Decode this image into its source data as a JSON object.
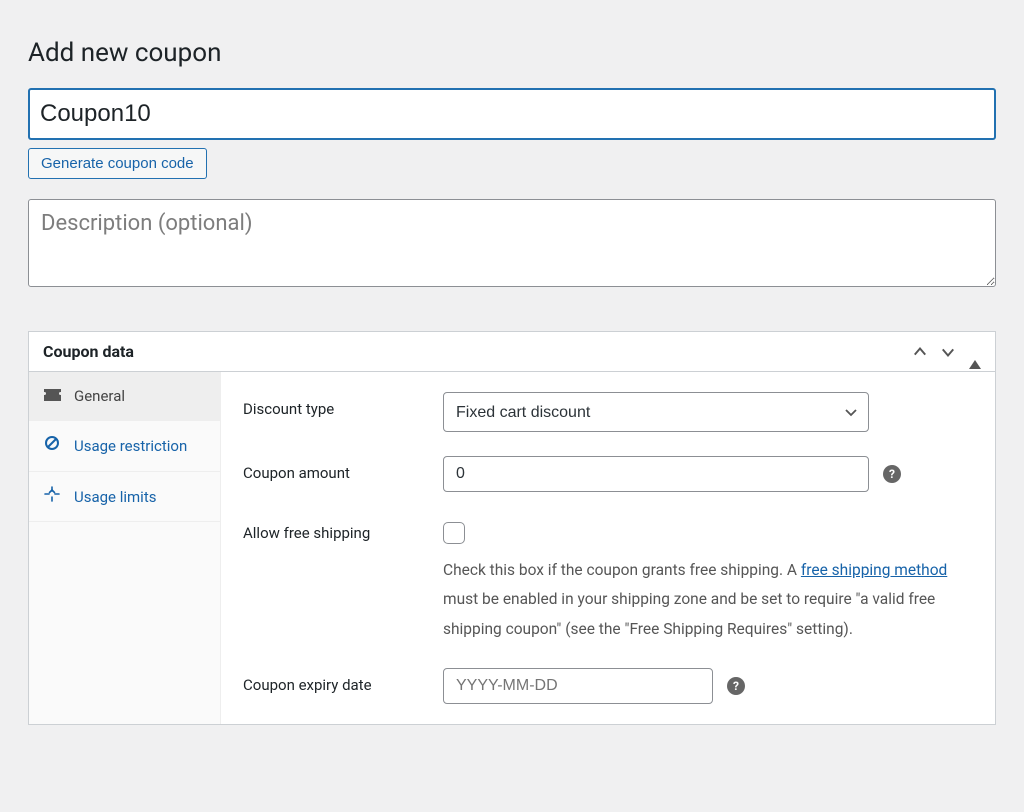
{
  "page_title": "Add new coupon",
  "coupon_code_value": "Coupon10",
  "generate_button_label": "Generate coupon code",
  "description_placeholder": "Description (optional)",
  "metabox": {
    "title": "Coupon data",
    "tabs": {
      "general": "General",
      "usage_restriction": "Usage restriction",
      "usage_limits": "Usage limits"
    },
    "general": {
      "discount_type_label": "Discount type",
      "discount_type_value": "Fixed cart discount",
      "coupon_amount_label": "Coupon amount",
      "coupon_amount_value": "0",
      "free_shipping_label": "Allow free shipping",
      "free_shipping_desc_1": "Check this box if the coupon grants free shipping. A ",
      "free_shipping_link": "free shipping method",
      "free_shipping_desc_2": " must be enabled in your shipping zone and be set to require \"a valid free shipping coupon\" (see the \"Free Shipping Requires\" setting).",
      "expiry_label": "Coupon expiry date",
      "expiry_placeholder": "YYYY-MM-DD"
    }
  }
}
